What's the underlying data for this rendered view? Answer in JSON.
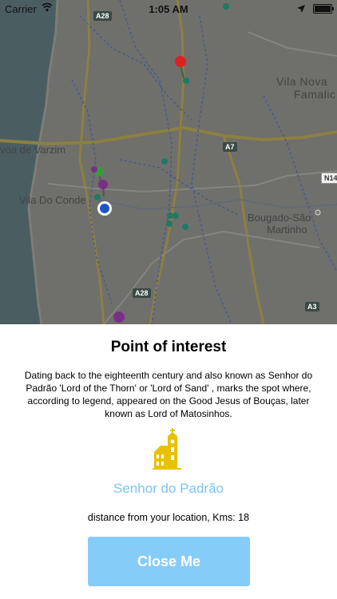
{
  "status_bar": {
    "carrier": "Carrier",
    "time": "1:05 AM"
  },
  "map": {
    "places": {
      "vila_nova": "Vila Nova",
      "famalic": "Famalic",
      "povoa": "voa de Varzim",
      "vila_do_conde": "Vila Do Conde",
      "bougado_line1": "Bougado-São",
      "bougado_line2": "Martinho"
    },
    "road_badges": {
      "a28_top": "A28",
      "a7": "A7",
      "n14": "N14",
      "a28_bottom": "A28",
      "a3": "A3"
    }
  },
  "sheet": {
    "title": "Point of interest",
    "description": "Dating back to the eighteenth century and also known as  Senhor do Padrão 'Lord of the Thorn' or 'Lord of Sand' , marks the spot where, according to legend, appeared on the Good Jesus of Bouças, later known as Lord of Matosinhos.",
    "poi_name": "Senhor do Padrão",
    "distance_text": "distance from your location, Kms: 18",
    "close_button": "Close Me",
    "icon": "church-icon",
    "colors": {
      "accent": "#78c5f0",
      "button": "#86ccf9",
      "icon": "#e8c200"
    }
  }
}
